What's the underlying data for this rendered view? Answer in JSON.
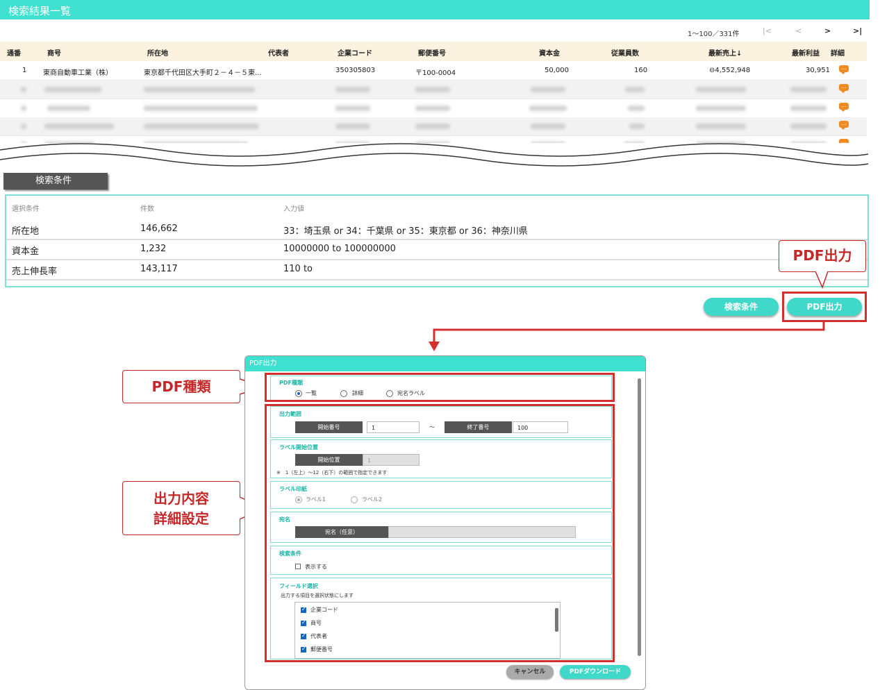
{
  "results": {
    "title": "検索結果一覧",
    "pager": {
      "text": "1〜100／331件",
      "first": "|<",
      "prev": "<",
      "next": ">",
      "last": ">|"
    },
    "columns": [
      "通番",
      "商号",
      "所在地",
      "代表者",
      "企業コード",
      "郵便番号",
      "資本金",
      "従業員数",
      "最新売上↓",
      "最新利益",
      "詳細"
    ],
    "first_row": {
      "no": "1",
      "name": "東商自動車工業（株）",
      "address": "東京都千代田区大手町２－４－５東...",
      "rep": "",
      "code": "350305803",
      "zip": "〒100-0004",
      "capital": "50,000",
      "employees": "160",
      "sales": "⊖4,552,948",
      "profit": "30,951"
    },
    "detail_icon": "chat-bubble-icon"
  },
  "conditions": {
    "tab_label": "検索条件",
    "headers": {
      "condition": "選択条件",
      "count": "件数",
      "input": "入力値"
    },
    "rows": [
      {
        "condition": "所在地",
        "count": "146,662",
        "input": "33：埼玉県 or 34：千葉県 or 35：東京都 or 36：神奈川県"
      },
      {
        "condition": "資本金",
        "count": "1,232",
        "input": "10000000 to 100000000"
      },
      {
        "condition": "売上伸長率",
        "count": "143,117",
        "input": "110 to"
      }
    ]
  },
  "buttons": {
    "search_conditions": "検索条件",
    "pdf_output": "PDF出力"
  },
  "callouts": {
    "pdf_output": "PDF出力",
    "pdf_type": "PDF種類",
    "detail_line1": "出力内容",
    "detail_line2": "詳細設定"
  },
  "dialog": {
    "title": "PDF出力",
    "pdf_type": {
      "label": "PDF種類",
      "options": [
        "一覧",
        "詳細",
        "宛名ラベル"
      ],
      "selected": "一覧"
    },
    "range": {
      "label": "出力範囲",
      "start_label": "開始番号",
      "start_value": "1",
      "tilde": "〜",
      "end_label": "終了番号",
      "end_value": "100"
    },
    "label_start": {
      "label": "ラベル開始位置",
      "field_label": "開始位置",
      "value": "1",
      "note": "※　1（左上）〜12（右下）の範囲で指定できます"
    },
    "label_paper": {
      "label": "ラベル印紙",
      "options": [
        "ラベル1",
        "ラベル2"
      ],
      "selected": "ラベル1"
    },
    "addressee": {
      "label": "宛名",
      "field_label": "宛名（任意）"
    },
    "search_cond": {
      "label": "検索条件",
      "checkbox": "表示する"
    },
    "fields": {
      "label": "フィールド選択",
      "hint": "出力する項目を選択状態にします",
      "items": [
        "企業コード",
        "商号",
        "代表者",
        "郵便番号"
      ]
    },
    "cancel": "キャンセル",
    "download": "PDFダウンロード"
  },
  "colors": {
    "teal": "#40e0d0",
    "red": "#d32f2f",
    "orange": "#f08a24"
  }
}
